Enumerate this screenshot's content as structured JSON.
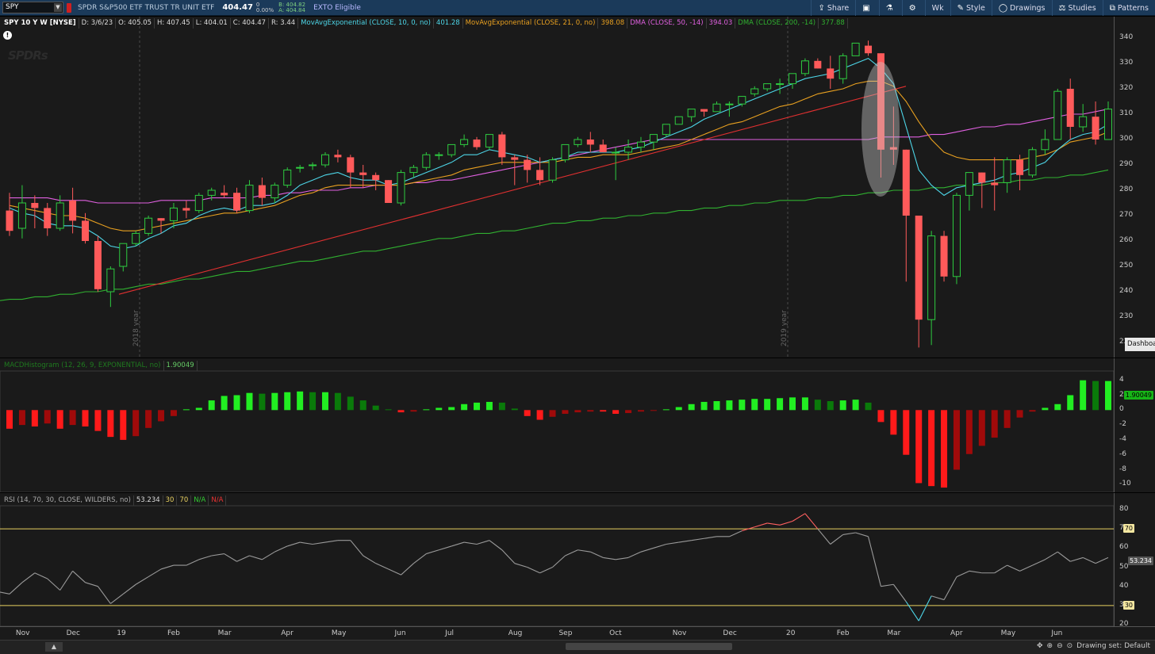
{
  "topbar": {
    "symbol": "SPY",
    "description": "SPDR S&P500 ETF TRUST TR UNIT ETF",
    "last": "404.47",
    "change": "0",
    "change_pct": "0.00%",
    "bid": "B: 404.82",
    "ask": "A: 404.84",
    "ext": "EXTO Eligible",
    "buttons": [
      {
        "label": "Share",
        "icon": "share-icon",
        "glyph": "⇪"
      },
      {
        "label": "",
        "icon": "grid-icon",
        "glyph": "▣"
      },
      {
        "label": "",
        "icon": "flask-icon",
        "glyph": "⚗"
      },
      {
        "label": "",
        "icon": "gear-icon",
        "glyph": "⚙"
      },
      {
        "label": "Wk",
        "icon": "",
        "glyph": ""
      },
      {
        "label": "Style",
        "icon": "style-icon",
        "glyph": "✎"
      },
      {
        "label": "Drawings",
        "icon": "drawings-icon",
        "glyph": "◯"
      },
      {
        "label": "Studies",
        "icon": "studies-icon",
        "glyph": "⚖"
      },
      {
        "label": "Patterns",
        "icon": "patterns-icon",
        "glyph": "⧉"
      }
    ]
  },
  "price_header": {
    "title": "SPY 10 Y W [NYSE]",
    "date": "D: 3/6/23",
    "open": "O: 405.05",
    "high": "H: 407.45",
    "low": "L: 404.01",
    "close": "C: 404.47",
    "range": "R: 3.44",
    "studies": [
      {
        "name": "MovAvgExponential (CLOSE, 10, 0, no)",
        "value": "401.28",
        "color": "#4dd6e8"
      },
      {
        "name": "MovAvgExponential (CLOSE, 21, 0, no)",
        "value": "398.08",
        "color": "#e8a020"
      },
      {
        "name": "DMA (CLOSE, 50, -14)",
        "value": "394.03",
        "color": "#e060e0"
      },
      {
        "name": "DMA (CLOSE, 200, -14)",
        "value": "377.88",
        "color": "#30b030"
      }
    ]
  },
  "watermark": "SPDRs",
  "dashboard_tab": "Dashboa",
  "price_axis": {
    "ticks": [
      "340",
      "330",
      "320",
      "310",
      "300",
      "290",
      "280",
      "270",
      "260",
      "250",
      "240",
      "230",
      "220"
    ]
  },
  "year_markers": [
    "2018 year",
    "2019 year"
  ],
  "macd_header": {
    "name": "MACDHistogram (12, 26, 9, EXPONENTIAL, no)",
    "value": "1.90049"
  },
  "macd_axis": {
    "ticks": [
      "4",
      "2",
      "0",
      "-2",
      "-4",
      "-6",
      "-8",
      "-10"
    ],
    "last": "1.90049"
  },
  "rsi_header": {
    "name": "RSI (14, 70, 30, CLOSE, WILDERS, no)",
    "value": "53.234",
    "ob": "30",
    "os": "70",
    "na1": "N/A",
    "na2": "N/A"
  },
  "rsi_axis": {
    "ticks": [
      "80",
      "70",
      "60",
      "50",
      "40",
      "30",
      "20"
    ],
    "last": "53.234",
    "tag70": "70",
    "tag30": "30"
  },
  "x_axis": [
    "Nov",
    "Dec",
    "19",
    "Feb",
    "Mar",
    "Apr",
    "May",
    "Jun",
    "Jul",
    "Aug",
    "Sep",
    "Oct",
    "Nov",
    "Dec",
    "20",
    "Feb",
    "Mar",
    "Apr",
    "May",
    "Jun"
  ],
  "bottom": {
    "drawing_set": "Drawing set: Default",
    "left_btn": "▲"
  },
  "colors": {
    "up": "#2ecc40",
    "down": "#ff5a5a",
    "ema10": "#4dd6e8",
    "ema21": "#e8a020",
    "dma50": "#e060e0",
    "dma200": "#30b030",
    "trend": "#e03030"
  },
  "chart_data": [
    {
      "type": "candlestick",
      "title": "SPY 10 Y W [NYSE]",
      "x": [
        "2018-10-29",
        "2018-11-05",
        "2018-11-12",
        "2018-11-19",
        "2018-11-26",
        "2018-12-03",
        "2018-12-10",
        "2018-12-17",
        "2018-12-24",
        "2018-12-31",
        "2019-01-07",
        "2019-01-14",
        "2019-01-21",
        "2019-01-28",
        "2019-02-04",
        "2019-02-11",
        "2019-02-18",
        "2019-02-25",
        "2019-03-04",
        "2019-03-11",
        "2019-03-18",
        "2019-03-25",
        "2019-04-01",
        "2019-04-08",
        "2019-04-15",
        "2019-04-22",
        "2019-04-29",
        "2019-05-06",
        "2019-05-13",
        "2019-05-20",
        "2019-05-27",
        "2019-06-03",
        "2019-06-10",
        "2019-06-17",
        "2019-06-24",
        "2019-07-01",
        "2019-07-08",
        "2019-07-15",
        "2019-07-22",
        "2019-07-29",
        "2019-08-05",
        "2019-08-12",
        "2019-08-19",
        "2019-08-26",
        "2019-09-02",
        "2019-09-09",
        "2019-09-16",
        "2019-09-23",
        "2019-09-30",
        "2019-10-07",
        "2019-10-14",
        "2019-10-21",
        "2019-10-28",
        "2019-11-04",
        "2019-11-11",
        "2019-11-18",
        "2019-11-25",
        "2019-12-02",
        "2019-12-09",
        "2019-12-16",
        "2019-12-23",
        "2019-12-30",
        "2020-01-06",
        "2020-01-13",
        "2020-01-20",
        "2020-01-27",
        "2020-02-03",
        "2020-02-10",
        "2020-02-17",
        "2020-02-24",
        "2020-03-02",
        "2020-03-09",
        "2020-03-16",
        "2020-03-23",
        "2020-03-30",
        "2020-04-06",
        "2020-04-13",
        "2020-04-20",
        "2020-04-27",
        "2020-05-04",
        "2020-05-11",
        "2020-05-18",
        "2020-05-25",
        "2020-06-01",
        "2020-06-08",
        "2020-06-15",
        "2020-06-22",
        "2020-06-29"
      ],
      "ohlc": [
        [
          272,
          279,
          262,
          264
        ],
        [
          265,
          282,
          261,
          275
        ],
        [
          275,
          278,
          265,
          273
        ],
        [
          273,
          275,
          262,
          265
        ],
        [
          265,
          278,
          264,
          275
        ],
        [
          276,
          281,
          263,
          268
        ],
        [
          268,
          271,
          259,
          260
        ],
        [
          260,
          262,
          240,
          241
        ],
        [
          240,
          250,
          234,
          249
        ],
        [
          250,
          258,
          248,
          259
        ],
        [
          259,
          264,
          258,
          263
        ],
        [
          263,
          270,
          262,
          269
        ],
        [
          269,
          268,
          263,
          268
        ],
        [
          268,
          275,
          265,
          273
        ],
        [
          273,
          276,
          269,
          272
        ],
        [
          272,
          279,
          271,
          278
        ],
        [
          278,
          281,
          276,
          280
        ],
        [
          279,
          282,
          277,
          278
        ],
        [
          279,
          281,
          271,
          272
        ],
        [
          272,
          284,
          271,
          282
        ],
        [
          282,
          285,
          274,
          277
        ],
        [
          277,
          283,
          275,
          282
        ],
        [
          282,
          289,
          281,
          288
        ],
        [
          289,
          290,
          287,
          289
        ],
        [
          290,
          291,
          288,
          290
        ],
        [
          290,
          295,
          289,
          294
        ],
        [
          294,
          296,
          291,
          293
        ],
        [
          293,
          294,
          281,
          287
        ],
        [
          287,
          290,
          281,
          286
        ],
        [
          286,
          287,
          280,
          284
        ],
        [
          284,
          284,
          275,
          275
        ],
        [
          275,
          288,
          274,
          287
        ],
        [
          287,
          290,
          285,
          289
        ],
        [
          289,
          295,
          288,
          294
        ],
        [
          294,
          295,
          292,
          294
        ],
        [
          294,
          298,
          293,
          298
        ],
        [
          298,
          302,
          297,
          300
        ],
        [
          300,
          301,
          296,
          297
        ],
        [
          297,
          302,
          296,
          302
        ],
        [
          302,
          303,
          290,
          293
        ],
        [
          293,
          294,
          282,
          292
        ],
        [
          292,
          294,
          283,
          288
        ],
        [
          288,
          293,
          282,
          284
        ],
        [
          284,
          293,
          283,
          292
        ],
        [
          292,
          298,
          291,
          298
        ],
        [
          298,
          301,
          297,
          300
        ],
        [
          300,
          303,
          295,
          298
        ],
        [
          298,
          300,
          295,
          295
        ],
        [
          295,
          297,
          284,
          295
        ],
        [
          295,
          300,
          292,
          297
        ],
        [
          297,
          301,
          295,
          299
        ],
        [
          299,
          302,
          296,
          302
        ],
        [
          302,
          306,
          301,
          306
        ],
        [
          306,
          309,
          306,
          309
        ],
        [
          309,
          312,
          307,
          312
        ],
        [
          312,
          312,
          309,
          311
        ],
        [
          311,
          315,
          311,
          314
        ],
        [
          314,
          315,
          309,
          314
        ],
        [
          314,
          317,
          313,
          317
        ],
        [
          318,
          321,
          317,
          320
        ],
        [
          320,
          322,
          319,
          322
        ],
        [
          322,
          324,
          318,
          322
        ],
        [
          322,
          326,
          320,
          326
        ],
        [
          326,
          332,
          325,
          331
        ],
        [
          331,
          332,
          328,
          328
        ],
        [
          328,
          333,
          320,
          324
        ],
        [
          324,
          334,
          322,
          333
        ],
        [
          333,
          338,
          333,
          338
        ],
        [
          337,
          339,
          333,
          334
        ],
        [
          334,
          315,
          285,
          296
        ],
        [
          297,
          313,
          290,
          296
        ],
        [
          296,
          289,
          244,
          270
        ],
        [
          270,
          263,
          218,
          229
        ],
        [
          229,
          264,
          219,
          262
        ],
        [
          262,
          264,
          244,
          246
        ],
        [
          246,
          279,
          243,
          278
        ],
        [
          278,
          287,
          272,
          287
        ],
        [
          287,
          287,
          273,
          283
        ],
        [
          283,
          293,
          272,
          282
        ],
        [
          283,
          293,
          279,
          292
        ],
        [
          292,
          294,
          280,
          286
        ],
        [
          286,
          297,
          285,
          296
        ],
        [
          296,
          304,
          294,
          300
        ],
        [
          300,
          320,
          300,
          319
        ],
        [
          320,
          324,
          300,
          305
        ],
        [
          305,
          314,
          303,
          309
        ],
        [
          309,
          315,
          298,
          300
        ],
        [
          300,
          315,
          300,
          312
        ]
      ],
      "ema10": [
        273,
        271,
        270,
        267,
        266,
        266,
        265,
        262,
        258,
        257,
        258,
        261,
        263,
        266,
        267,
        270,
        272,
        273,
        272,
        274,
        274,
        275,
        278,
        282,
        284,
        286,
        287,
        285,
        284,
        284,
        282,
        283,
        285,
        287,
        289,
        291,
        294,
        294,
        296,
        295,
        294,
        293,
        291,
        292,
        293,
        295,
        295,
        295,
        295,
        296,
        297,
        299,
        301,
        303,
        305,
        308,
        310,
        312,
        314,
        316,
        318,
        320,
        322,
        324,
        325,
        326,
        328,
        330,
        332,
        328,
        322,
        305,
        288,
        282,
        278,
        281,
        282,
        283,
        284,
        286,
        287,
        289,
        291,
        296,
        300,
        302,
        303,
        306
      ],
      "ema21": [
        274,
        273,
        272,
        271,
        270,
        270,
        269,
        267,
        265,
        264,
        264,
        265,
        266,
        267,
        268,
        269,
        270,
        271,
        271,
        272,
        273,
        274,
        276,
        278,
        279,
        281,
        282,
        282,
        282,
        282,
        282,
        282,
        283,
        284,
        285,
        286,
        288,
        289,
        290,
        291,
        291,
        291,
        291,
        291,
        292,
        293,
        293,
        294,
        294,
        294,
        295,
        296,
        297,
        298,
        300,
        302,
        304,
        306,
        307,
        309,
        311,
        313,
        314,
        316,
        318,
        319,
        320,
        322,
        323,
        323,
        321,
        315,
        307,
        300,
        295,
        293,
        292,
        292,
        292,
        292,
        292,
        293,
        294,
        296,
        299,
        300,
        301,
        303
      ],
      "dma50": [
        277,
        277,
        277,
        277,
        276,
        276,
        276,
        275,
        275,
        275,
        275,
        275,
        276,
        276,
        276,
        276,
        277,
        277,
        277,
        277,
        278,
        278,
        279,
        279,
        280,
        280,
        280,
        281,
        281,
        282,
        282,
        282,
        283,
        283,
        284,
        284,
        285,
        286,
        287,
        288,
        289,
        290,
        291,
        292,
        293,
        294,
        295,
        296,
        297,
        298,
        299,
        300,
        300,
        300,
        300,
        300,
        300,
        300,
        300,
        300,
        300,
        300,
        300,
        300,
        300,
        300,
        300,
        300,
        300,
        301,
        301,
        301,
        301,
        302,
        302,
        303,
        304,
        305,
        305,
        306,
        306,
        307,
        308,
        309,
        310,
        310,
        311,
        312
      ],
      "dma200": [
        237,
        237,
        238,
        238,
        239,
        239,
        240,
        240,
        241,
        241,
        242,
        243,
        243,
        244,
        245,
        245,
        246,
        247,
        248,
        248,
        249,
        250,
        251,
        252,
        252,
        253,
        254,
        255,
        256,
        256,
        257,
        258,
        259,
        260,
        261,
        261,
        262,
        263,
        263,
        264,
        264,
        265,
        266,
        267,
        267,
        268,
        268,
        269,
        269,
        270,
        270,
        271,
        271,
        272,
        272,
        273,
        273,
        274,
        274,
        275,
        275,
        276,
        276,
        276,
        277,
        277,
        278,
        278,
        279,
        279,
        280,
        280,
        280,
        281,
        281,
        282,
        282,
        282,
        283,
        283,
        284,
        284,
        285,
        285,
        286,
        286,
        287,
        288
      ],
      "ylim": [
        215,
        345
      ]
    },
    {
      "type": "bar",
      "title": "MACDHistogram (12, 26, 9, EXPONENTIAL, no)",
      "values": [
        -2.5,
        -2.0,
        -2.2,
        -1.8,
        -2.5,
        -2.0,
        -2.2,
        -2.8,
        -3.6,
        -4.0,
        -3.5,
        -2.4,
        -1.5,
        -0.8,
        0.1,
        0.3,
        1.3,
        1.9,
        2.0,
        2.3,
        2.2,
        2.3,
        2.4,
        2.5,
        2.4,
        2.4,
        2.3,
        1.8,
        1.3,
        0.6,
        0.1,
        -0.3,
        -0.2,
        0.1,
        0.3,
        0.4,
        0.8,
        1.0,
        1.1,
        1.0,
        0.2,
        -0.8,
        -1.3,
        -0.9,
        -0.5,
        -0.3,
        -0.2,
        -0.2,
        -0.5,
        -0.4,
        -0.2,
        -0.1,
        0.1,
        0.4,
        0.8,
        1.1,
        1.2,
        1.3,
        1.4,
        1.5,
        1.5,
        1.6,
        1.7,
        1.7,
        1.4,
        1.2,
        1.3,
        1.4,
        1.0,
        -1.6,
        -3.3,
        -6.0,
        -9.8,
        -10.2,
        -10.4,
        -8.0,
        -5.9,
        -4.8,
        -3.7,
        -2.4,
        -1.0,
        -0.2,
        0.3,
        0.8,
        2.0,
        4.0,
        3.9,
        3.9,
        3.3,
        3.6
      ],
      "ylim": [
        -10.5,
        4.5
      ]
    },
    {
      "type": "line",
      "title": "RSI (14, 70, 30, CLOSE, WILDERS, no)",
      "values": [
        36,
        42,
        47,
        44,
        38,
        48,
        42,
        40,
        31,
        36,
        41,
        45,
        49,
        51,
        51,
        54,
        56,
        57,
        53,
        56,
        54,
        58,
        61,
        63,
        62,
        63,
        64,
        64,
        56,
        52,
        49,
        46,
        52,
        57,
        59,
        61,
        63,
        62,
        64,
        59,
        52,
        50,
        47,
        50,
        56,
        59,
        58,
        55,
        54,
        55,
        58,
        60,
        62,
        63,
        64,
        65,
        66,
        66,
        69,
        71,
        73,
        72,
        74,
        78,
        70,
        62,
        67,
        68,
        66,
        40,
        41,
        32,
        22,
        35,
        33,
        45,
        48,
        47,
        47,
        51,
        48,
        51,
        54,
        58,
        53,
        55,
        52,
        55
      ],
      "ylim": [
        19,
        83
      ],
      "levels": [
        30,
        70
      ]
    }
  ]
}
